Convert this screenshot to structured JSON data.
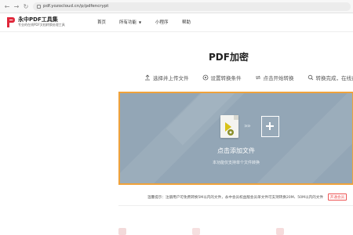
{
  "browser": {
    "url": "pdf.yozocloud.cn/p/pdfencrypt",
    "icons": [
      "back-icon",
      "forward-icon",
      "reload-icon",
      "lock-icon"
    ]
  },
  "header": {
    "brand_name": "永中PDF工具集",
    "brand_sub": "专业的在线PDF文档转换处理工具",
    "nav": [
      "首页",
      "所有功能",
      "小程序",
      "帮助"
    ]
  },
  "main": {
    "title": "PDF加密",
    "steps": [
      {
        "icon": "upload-icon",
        "label": "选择并上传文件"
      },
      {
        "icon": "settings-icon",
        "label": "设置转换条件"
      },
      {
        "icon": "convert-icon",
        "label": "点击开始转换"
      },
      {
        "icon": "search-icon",
        "label": "转换完成，在线查看"
      }
    ],
    "dropzone": {
      "title": "点击添加文件",
      "subtitle": "本功能仅支持单个文件转换"
    },
    "tip": "温馨提示：注册用户可免费转换5M以内的文件，永中会员权益版会员单文件可支持转换20M、50M以内的文件",
    "tip_button": "开通会员"
  },
  "colors": {
    "accent": "#f0a23a",
    "dropzone_bg": "#93a6b6",
    "brand_red": "#e0283b"
  }
}
